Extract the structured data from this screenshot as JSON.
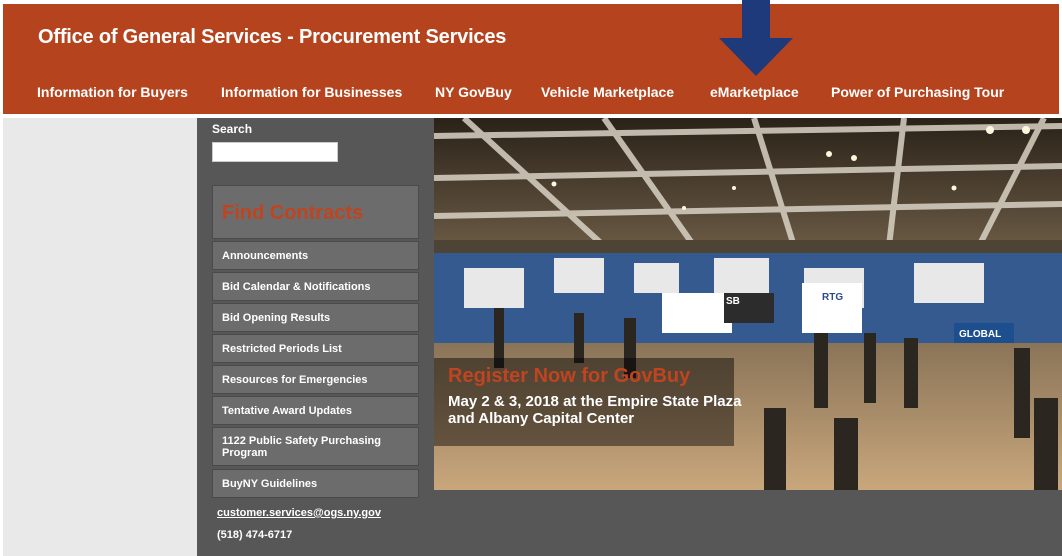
{
  "header": {
    "title": "Office of General Services - Procurement Services",
    "nav": [
      "Information for Buyers",
      "Information for Businesses",
      "NY GovBuy",
      "Vehicle Marketplace",
      "eMarketplace",
      "Power of Purchasing Tour"
    ]
  },
  "sidebar": {
    "search_label": "Search",
    "search_value": "",
    "find_contracts": "Find Contracts",
    "menu": [
      "Announcements",
      "Bid Calendar & Notifications",
      "Bid Opening Results",
      "Restricted Periods List",
      "Resources for Emergencies",
      "Tentative Award Updates",
      "1122 Public Safety Purchasing Program",
      "BuyNY Guidelines"
    ],
    "email": "customer.services@ogs.ny.gov",
    "phone": "(518) 474-6717"
  },
  "hero": {
    "title": "Register Now for GovBuy",
    "text": "May 2 & 3, 2018 at the Empire State Plaza and Albany Capital Center",
    "booth_labels": [
      "RTG",
      "SB",
      "GLOBAL"
    ]
  },
  "colors": {
    "header_bg": "#b5441e",
    "sidebar_bg": "#575757",
    "accent": "#c0441f",
    "arrow": "#1f3a7a"
  },
  "icons": {
    "arrow": "down-arrow-icon"
  }
}
